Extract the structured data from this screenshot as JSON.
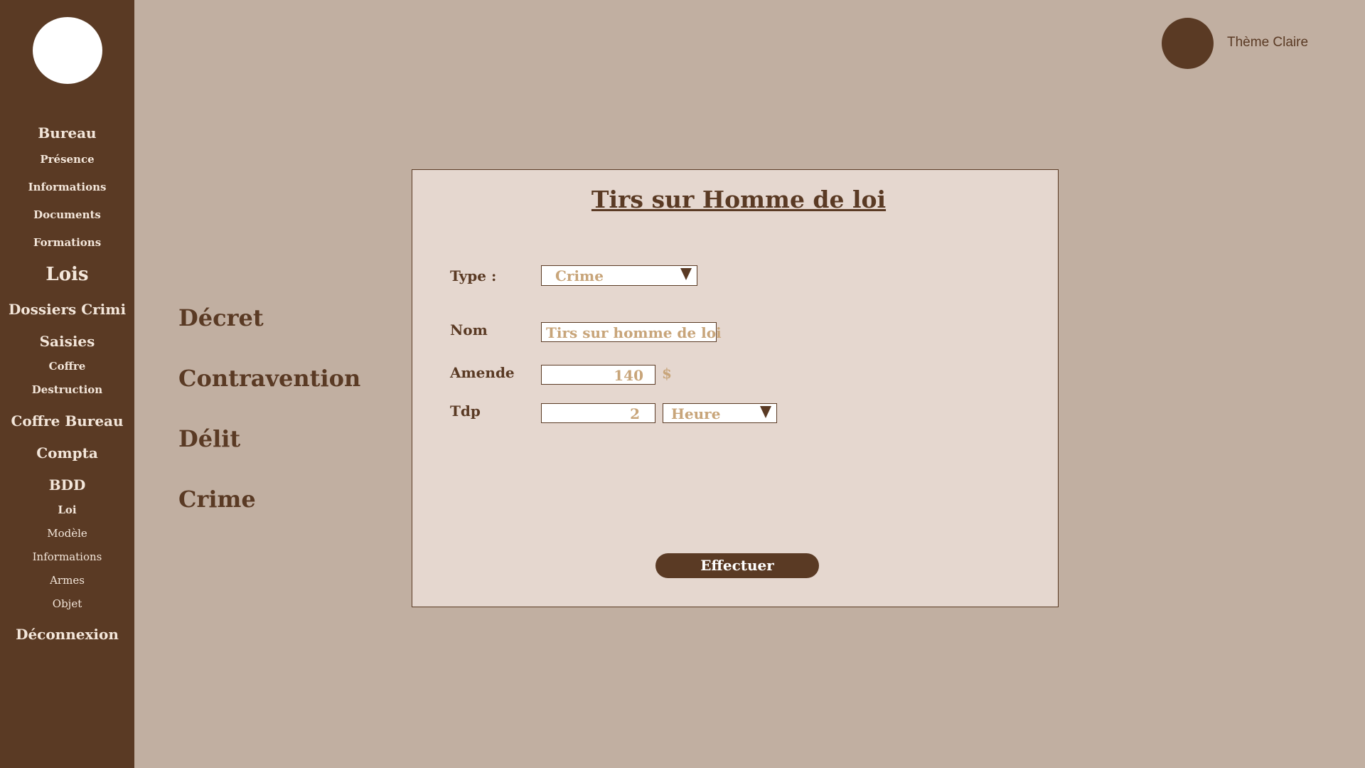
{
  "sidebar": {
    "logo": "logo",
    "items": [
      {
        "label": "Bureau"
      },
      {
        "label": "Présence"
      },
      {
        "label": "Informations"
      },
      {
        "label": "Documents"
      },
      {
        "label": "Formations"
      },
      {
        "label": "Lois"
      },
      {
        "label": "Dossiers Crimi"
      },
      {
        "label": "Saisies"
      },
      {
        "label": "Coffre"
      },
      {
        "label": "Destruction"
      },
      {
        "label": "Coffre Bureau"
      },
      {
        "label": "Compta"
      },
      {
        "label": "BDD"
      },
      {
        "label": "Loi"
      },
      {
        "label": "Modèle"
      },
      {
        "label": "Informations"
      },
      {
        "label": "Armes"
      },
      {
        "label": "Objet"
      },
      {
        "label": "Déconnexion"
      }
    ]
  },
  "categories": [
    "Décret",
    "Contravention",
    "Délit",
    "Crime"
  ],
  "theme": {
    "label": "Thème Claire"
  },
  "form": {
    "title": "Tirs sur Homme de loi",
    "type_label": "Type :",
    "type_value": "Crime",
    "nom_label": "Nom",
    "nom_value": "Tirs sur homme de loi",
    "amende_label": "Amende",
    "amende_value": "140",
    "amende_unit": "$",
    "tdp_label": "Tdp",
    "tdp_value": "2",
    "tdp_unit_value": "Heure",
    "submit_label": "Effectuer"
  },
  "colors": {
    "sidebar": "#5a3a24",
    "background": "#c1afa1",
    "panel": "#e5d7cf",
    "accent_text": "#c8a57a"
  }
}
